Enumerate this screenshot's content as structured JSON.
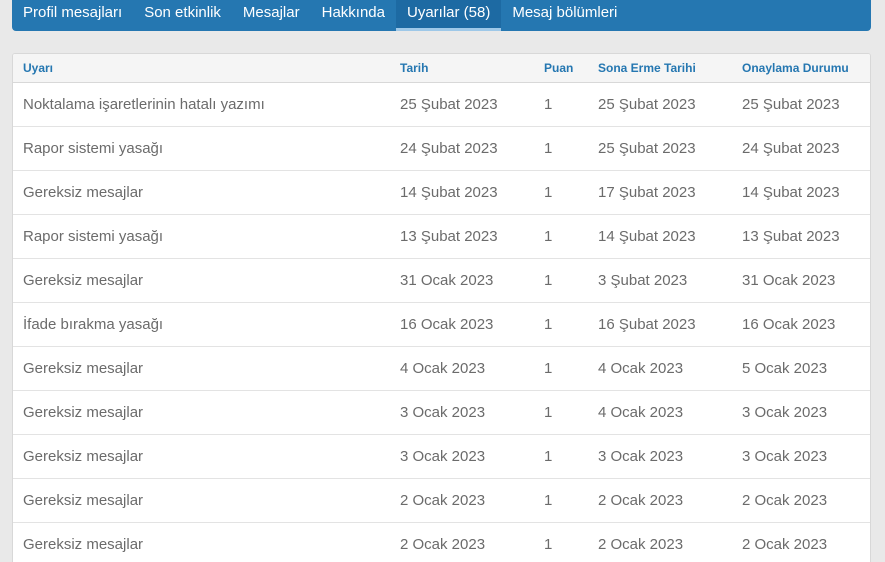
{
  "tabs": [
    {
      "label": "Profil mesajları"
    },
    {
      "label": "Son etkinlik"
    },
    {
      "label": "Mesajlar"
    },
    {
      "label": "Hakkında"
    },
    {
      "label": "Uyarılar (58)"
    },
    {
      "label": "Mesaj bölümleri"
    }
  ],
  "active_tab": 4,
  "table": {
    "headers": [
      "Uyarı",
      "Tarih",
      "Puan",
      "Sona Erme Tarihi",
      "Onaylama Durumu"
    ],
    "rows": [
      [
        "Noktalama işaretlerinin hatalı yazımı",
        "25 Şubat 2023",
        "1",
        "25 Şubat 2023",
        "25 Şubat 2023"
      ],
      [
        "Rapor sistemi yasağı",
        "24 Şubat 2023",
        "1",
        "25 Şubat 2023",
        "24 Şubat 2023"
      ],
      [
        "Gereksiz mesajlar",
        "14 Şubat 2023",
        "1",
        "17 Şubat 2023",
        "14 Şubat 2023"
      ],
      [
        "Rapor sistemi yasağı",
        "13 Şubat 2023",
        "1",
        "14 Şubat 2023",
        "13 Şubat 2023"
      ],
      [
        "Gereksiz mesajlar",
        "31 Ocak 2023",
        "1",
        "3 Şubat 2023",
        "31 Ocak 2023"
      ],
      [
        "İfade bırakma yasağı",
        "16 Ocak 2023",
        "1",
        "16 Şubat 2023",
        "16 Ocak 2023"
      ],
      [
        "Gereksiz mesajlar",
        "4 Ocak 2023",
        "1",
        "4 Ocak 2023",
        "5 Ocak 2023"
      ],
      [
        "Gereksiz mesajlar",
        "3 Ocak 2023",
        "1",
        "4 Ocak 2023",
        "3 Ocak 2023"
      ],
      [
        "Gereksiz mesajlar",
        "3 Ocak 2023",
        "1",
        "3 Ocak 2023",
        "3 Ocak 2023"
      ],
      [
        "Gereksiz mesajlar",
        "2 Ocak 2023",
        "1",
        "2 Ocak 2023",
        "2 Ocak 2023"
      ],
      [
        "Gereksiz mesajlar",
        "2 Ocak 2023",
        "1",
        "2 Ocak 2023",
        "2 Ocak 2023"
      ]
    ]
  }
}
